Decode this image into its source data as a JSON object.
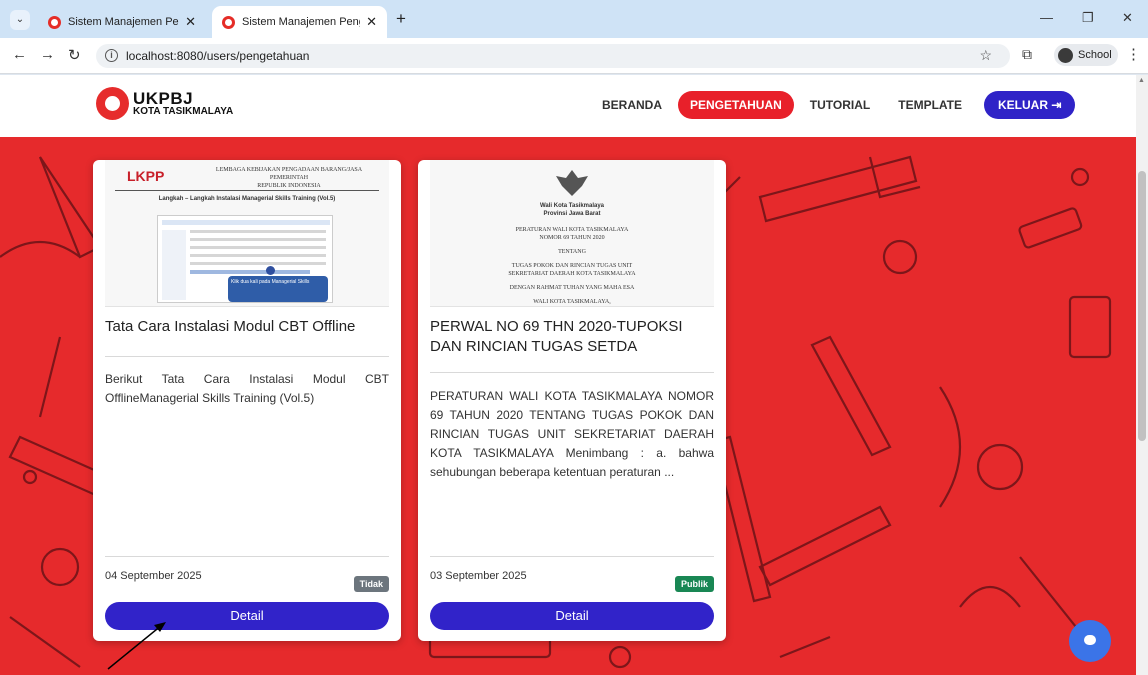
{
  "browser": {
    "tabs": [
      {
        "title": "Sistem Manajemen Pengetahuan",
        "active": false
      },
      {
        "title": "Sistem Manajemen Pengetahuan",
        "active": true
      }
    ],
    "url": "localhost:8080/users/pengetahuan",
    "profile_label": "School"
  },
  "site": {
    "logo_line1": "UKPBJ",
    "logo_line2": "KOTA TASIKMALAYA",
    "nav": [
      {
        "label": "BERANDA",
        "active": false
      },
      {
        "label": "PENGETAHUAN",
        "active": true
      },
      {
        "label": "TUTORIAL",
        "active": false
      },
      {
        "label": "TEMPLATE",
        "active": false
      }
    ],
    "logout_label": "KELUAR ⇥"
  },
  "cards": [
    {
      "thumb": {
        "logo": "LKPP",
        "header_lines": [
          "LEMBAGA KEBIJAKAN PENGADAAN BARANG/JASA PEMERINTAH",
          "REPUBLIK INDONESIA"
        ],
        "heading": "Langkah – Langkah Instalasi Managerial Skills Training (Vol.5)",
        "callout": "Klik dua kali pada Managerial Skills"
      },
      "title": "Tata Cara Instalasi Modul CBT Offline",
      "description": "Berikut Tata Cara Instalasi Modul CBT OfflineManagerial Skills Training (Vol.5)",
      "date": "04 September 2025",
      "badge": "Tidak",
      "badge_color": "#6c757d",
      "button_label": "Detail"
    },
    {
      "thumb": {
        "lines": [
          "Wali Kota Tasikmalaya",
          "Provinsi Jawa Barat",
          "PERATURAN WALI KOTA TASIKMALAYA",
          "NOMOR 69 TAHUN 2020",
          "TENTANG",
          "TUGAS POKOK DAN RINCIAN TUGAS UNIT",
          "SEKRETARIAT DAERAH KOTA TASIKMALAYA",
          "DENGAN RAHMAT TUHAN YANG MAHA ESA",
          "WALI KOTA TASIKMALAYA,"
        ]
      },
      "title": "PERWAL NO 69 THN 2020-TUPOKSI DAN RINCIAN TUGAS SETDA",
      "description": "PERATURAN WALI KOTA TASIKMALAYA NOMOR 69 TAHUN 2020 TENTANG TUGAS POKOK DAN RINCIAN TUGAS UNIT SEKRETARIAT DAERAH KOTA TASIKMALAYA Menimbang : a. bahwa sehubungan beberapa ketentuan peraturan ...",
      "date": "03 September 2025",
      "badge": "Publik",
      "badge_color": "#198754",
      "button_label": "Detail"
    }
  ],
  "colors": {
    "brand_red": "#e62a2c",
    "button_blue": "#3123c9"
  }
}
